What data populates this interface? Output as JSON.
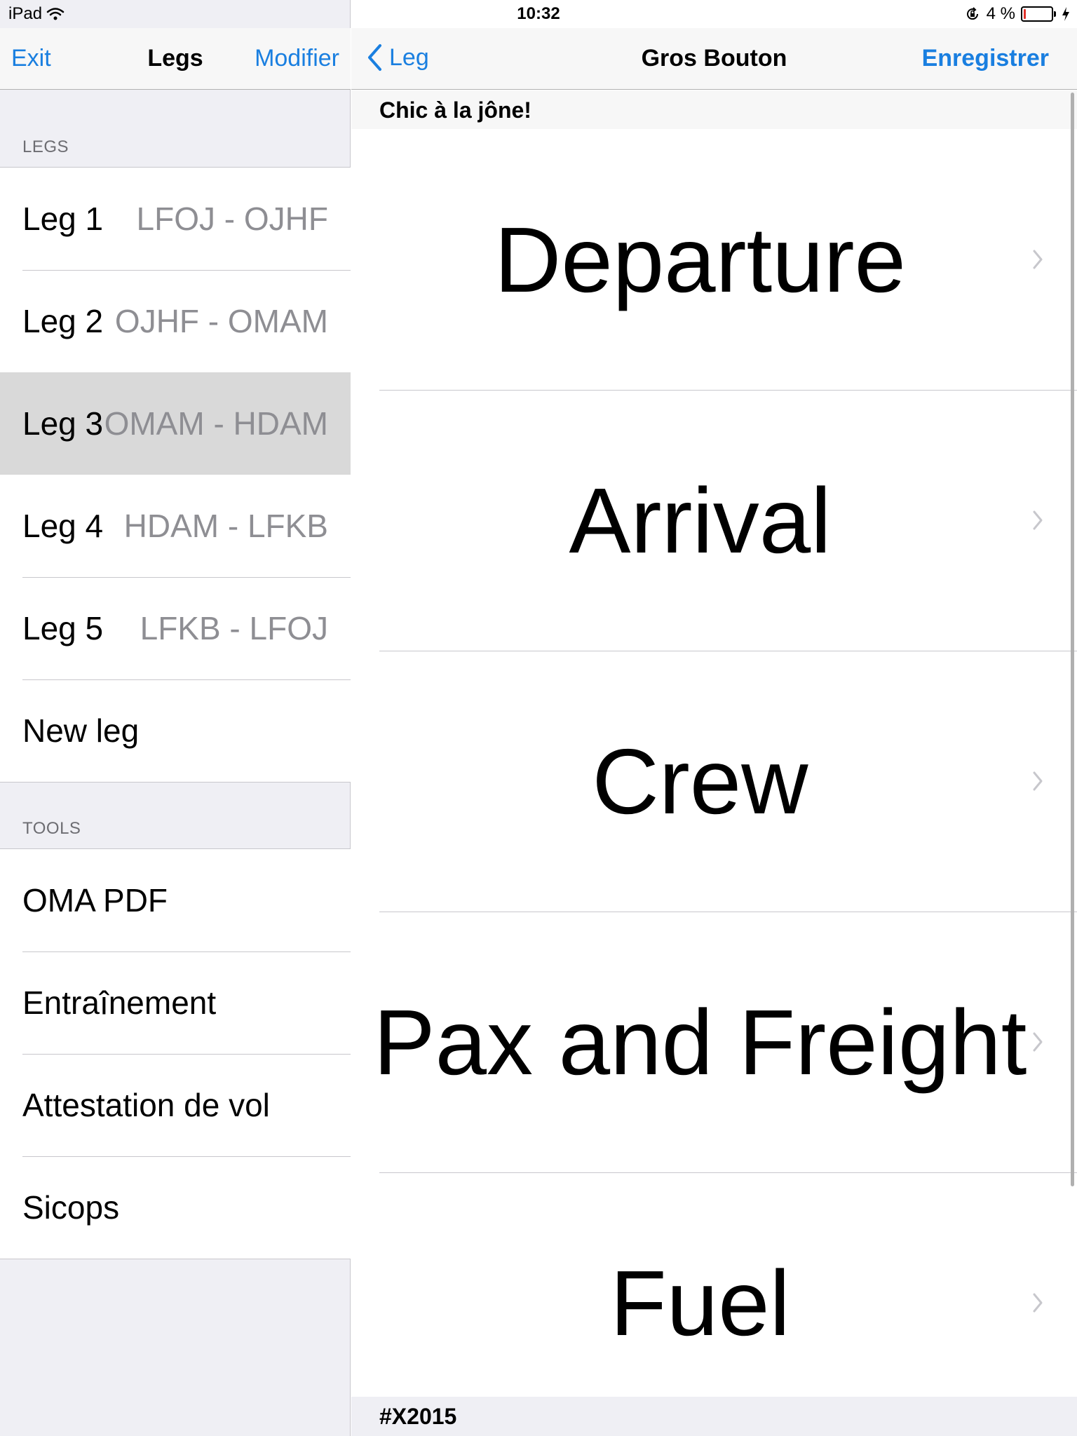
{
  "status_bar": {
    "device": "iPad",
    "time": "10:32",
    "battery_percent": "4 %",
    "battery_level": 0.04,
    "icons": [
      "wifi-icon",
      "rotation-lock-icon",
      "battery-icon",
      "charging-icon"
    ]
  },
  "master": {
    "exit_label": "Exit",
    "title": "Legs",
    "modify_label": "Modifier",
    "legs_header": "LEGS",
    "legs": [
      {
        "name": "Leg 1",
        "route": "LFOJ - OJHF"
      },
      {
        "name": "Leg 2",
        "route": "OJHF - OMAM"
      },
      {
        "name": "Leg 3",
        "route": "OMAM - HDAM"
      },
      {
        "name": "Leg 4",
        "route": "HDAM - LFKB"
      },
      {
        "name": "Leg 5",
        "route": "LFKB - LFOJ"
      }
    ],
    "selected_leg": "Leg 3",
    "new_leg_label": "New leg",
    "tools_header": "TOOLS",
    "tools": [
      "OMA PDF",
      "Entraînement",
      "Attestation de vol",
      "Sicops"
    ]
  },
  "detail": {
    "back_label": "Leg",
    "title": "Gros Bouton",
    "save_label": "Enregistrer",
    "header": "Chic à la jône!",
    "rows": [
      "Departure",
      "Arrival",
      "Crew",
      "Pax and Freight",
      "Fuel"
    ],
    "footer": "#X2015"
  },
  "colors": {
    "accent": "#1a7fe0",
    "secondary_text": "#8e8e93",
    "selected_background": "#d9d9d9",
    "grouped_background": "#efeff4",
    "battery_low": "#e0322a"
  }
}
